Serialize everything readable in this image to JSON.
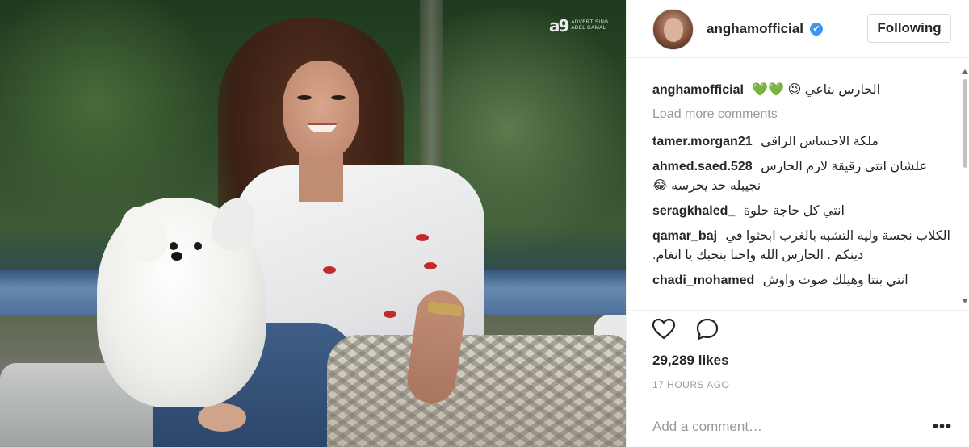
{
  "post": {
    "watermark": {
      "logo": "a9",
      "line1": "Advertising",
      "line2": "Adel Gamal"
    }
  },
  "header": {
    "username": "anghamofficial",
    "verified_mark": "✔",
    "follow_label": "Following"
  },
  "comments": {
    "caption": {
      "user": "anghamofficial",
      "text": "الحارس بتاعي 😉",
      "hearts": "💚💚"
    },
    "load_more": "Load more comments",
    "items": [
      {
        "user": "tamer.morgan21",
        "text": "ملكة الاحساس الراقي"
      },
      {
        "user": "ahmed.saed.528",
        "text": "علشان انتي رقيقة لازم الحارس نجيبله حد يحرسه 😂"
      },
      {
        "user": "seragkhaled_",
        "text": "انتي كل حاجة حلوة"
      },
      {
        "user": "qamar_baj",
        "text": "الكلاب نجسة وليه التشبه بالغرب ابحثوا في دينكم . الحارس الله واحنا بنحبك يا انغام."
      },
      {
        "user": "chadi_mohamed",
        "text": "انتي بنتا وهيلك صوت واوش"
      }
    ]
  },
  "actions": {
    "like_icon": "heart-outline",
    "comment_icon": "comment-bubble",
    "likes_text": "29,289 likes",
    "timestamp": "17 hours ago"
  },
  "add_comment": {
    "placeholder": "Add a comment…",
    "more_label": "•••"
  }
}
